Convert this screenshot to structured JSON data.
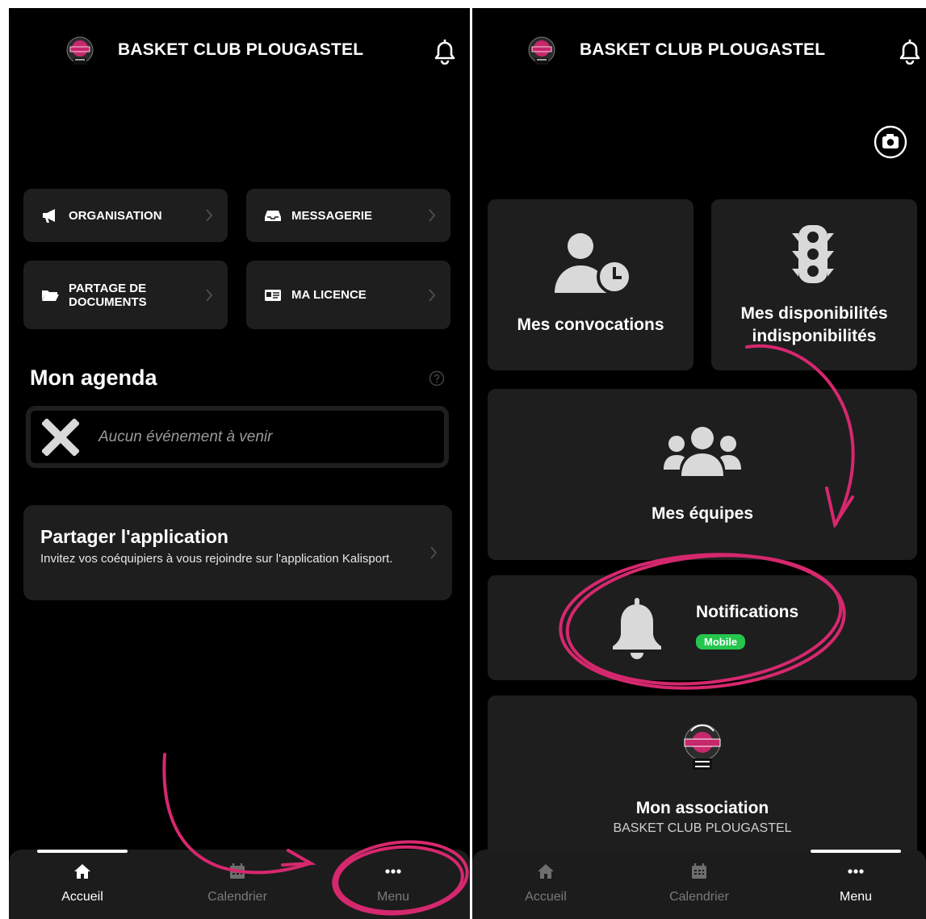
{
  "left": {
    "header": {
      "title": "BASKET CLUB PLOUGASTEL"
    },
    "quick_links": [
      {
        "label": "ORGANISATION",
        "icon": "megaphone-icon"
      },
      {
        "label": "MESSAGERIE",
        "icon": "inbox-icon"
      },
      {
        "label": "PARTAGE DE DOCUMENTS",
        "icon": "folder-icon"
      },
      {
        "label": "MA LICENCE",
        "icon": "id-card-icon"
      }
    ],
    "agenda": {
      "title": "Mon agenda",
      "empty_text": "Aucun événement à venir"
    },
    "share": {
      "title": "Partager l'application",
      "description": "Invitez vos coéquipiers à vous rejoindre sur l'application Kalisport."
    },
    "tabbar": {
      "tabs": [
        {
          "label": "Accueil",
          "icon": "home-icon",
          "active": true
        },
        {
          "label": "Calendrier",
          "icon": "calendar-icon",
          "active": false
        },
        {
          "label": "Menu",
          "icon": "more-icon",
          "active": false
        }
      ]
    }
  },
  "right": {
    "header": {
      "title": "BASKET CLUB PLOUGASTEL"
    },
    "tiles": {
      "convocations": "Mes convocations",
      "availability_line1": "Mes disponibilités",
      "availability_line2": "indisponibilités",
      "teams": "Mes équipes",
      "notifications": "Notifications",
      "notifications_badge": "Mobile",
      "association": "Mon association",
      "association_name": "BASKET CLUB PLOUGASTEL"
    },
    "tabbar": {
      "tabs": [
        {
          "label": "Accueil",
          "icon": "home-icon",
          "active": false
        },
        {
          "label": "Calendrier",
          "icon": "calendar-icon",
          "active": false
        },
        {
          "label": "Menu",
          "icon": "more-icon",
          "active": true
        }
      ]
    }
  },
  "colors": {
    "background": "#000000",
    "card": "#1e1e1e",
    "annotation": "#d6286e",
    "badge": "#25c64e",
    "logo_pink": "#c7276b"
  }
}
